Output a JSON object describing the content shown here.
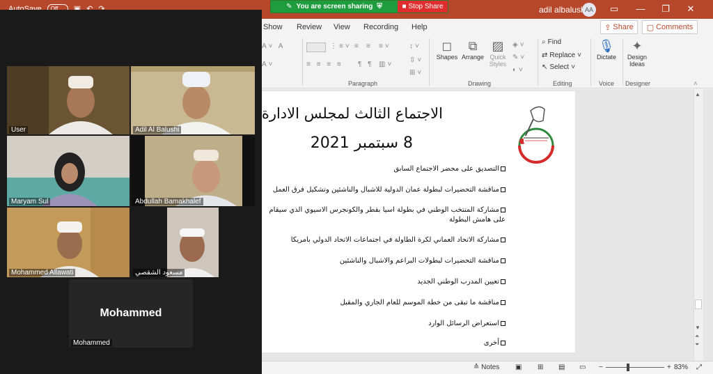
{
  "window": {
    "autosave_label": "AutoSave",
    "autosave_state": "Off",
    "user_name": "adil albalushi",
    "user_initials": "AA"
  },
  "share_banner": {
    "message": "You are screen sharing",
    "stop_label": "Stop Share"
  },
  "menu": {
    "items": [
      "Show",
      "Review",
      "View",
      "Recording",
      "Help"
    ],
    "share_label": "Share",
    "comments_label": "Comments"
  },
  "ribbon": {
    "groups": {
      "paragraph": "Paragraph",
      "drawing": "Drawing",
      "editing": "Editing",
      "voice": "Voice",
      "designer": "Designer"
    },
    "shapes_label": "Shapes",
    "arrange_label": "Arrange",
    "quick_styles_label": "Quick Styles",
    "find_label": "Find",
    "replace_label": "Replace",
    "select_label": "Select",
    "dictate_label": "Dictate",
    "design_ideas_label": "Design Ideas"
  },
  "slide": {
    "title": "الاجتماع الثالث لمجلس الادارة",
    "date": "8 سبتمبر 2021",
    "agenda": [
      "التصديق على محضر الاجتماع السابق",
      "مناقشة التحضيرات لبطولة عمان الدولية للاشبال والناشئين وتشكيل فرق العمل",
      "مشاركة المنتخب الوطني في بطولة اسيا بقطر والكونجرس الاسيوي الذي سيقام على هامش البطولة",
      "مشاركة الاتحاد العماني لكرة الطاولة في اجتماعات الاتحاد الدولي بامريكا",
      "مناقشة التحضيرات لبطولات البراعم والاشبال والناشئين",
      "تعيين المدرب الوطني الجديد",
      "مناقشة ما تبقى من خطة الموسم للعام الجاري والمقبل",
      "استعراض الرسائل الوارد",
      "أخرى"
    ]
  },
  "statusbar": {
    "notes_label": "Notes",
    "zoom_level": "83%"
  },
  "zoom": {
    "participants": [
      "User",
      "Adil Al Balushi",
      "Maryam Sul",
      "Abdullah Bamakhalef",
      "Mohammed Allawati",
      "مسعود الشقصي",
      "Mohammed"
    ],
    "video_off_name": "Mohammed"
  },
  "colors": {
    "accent": "#b7472a",
    "share_green": "#1f9c3e",
    "stop_red": "#e02d2d",
    "active_speaker": "#c9d34a"
  }
}
